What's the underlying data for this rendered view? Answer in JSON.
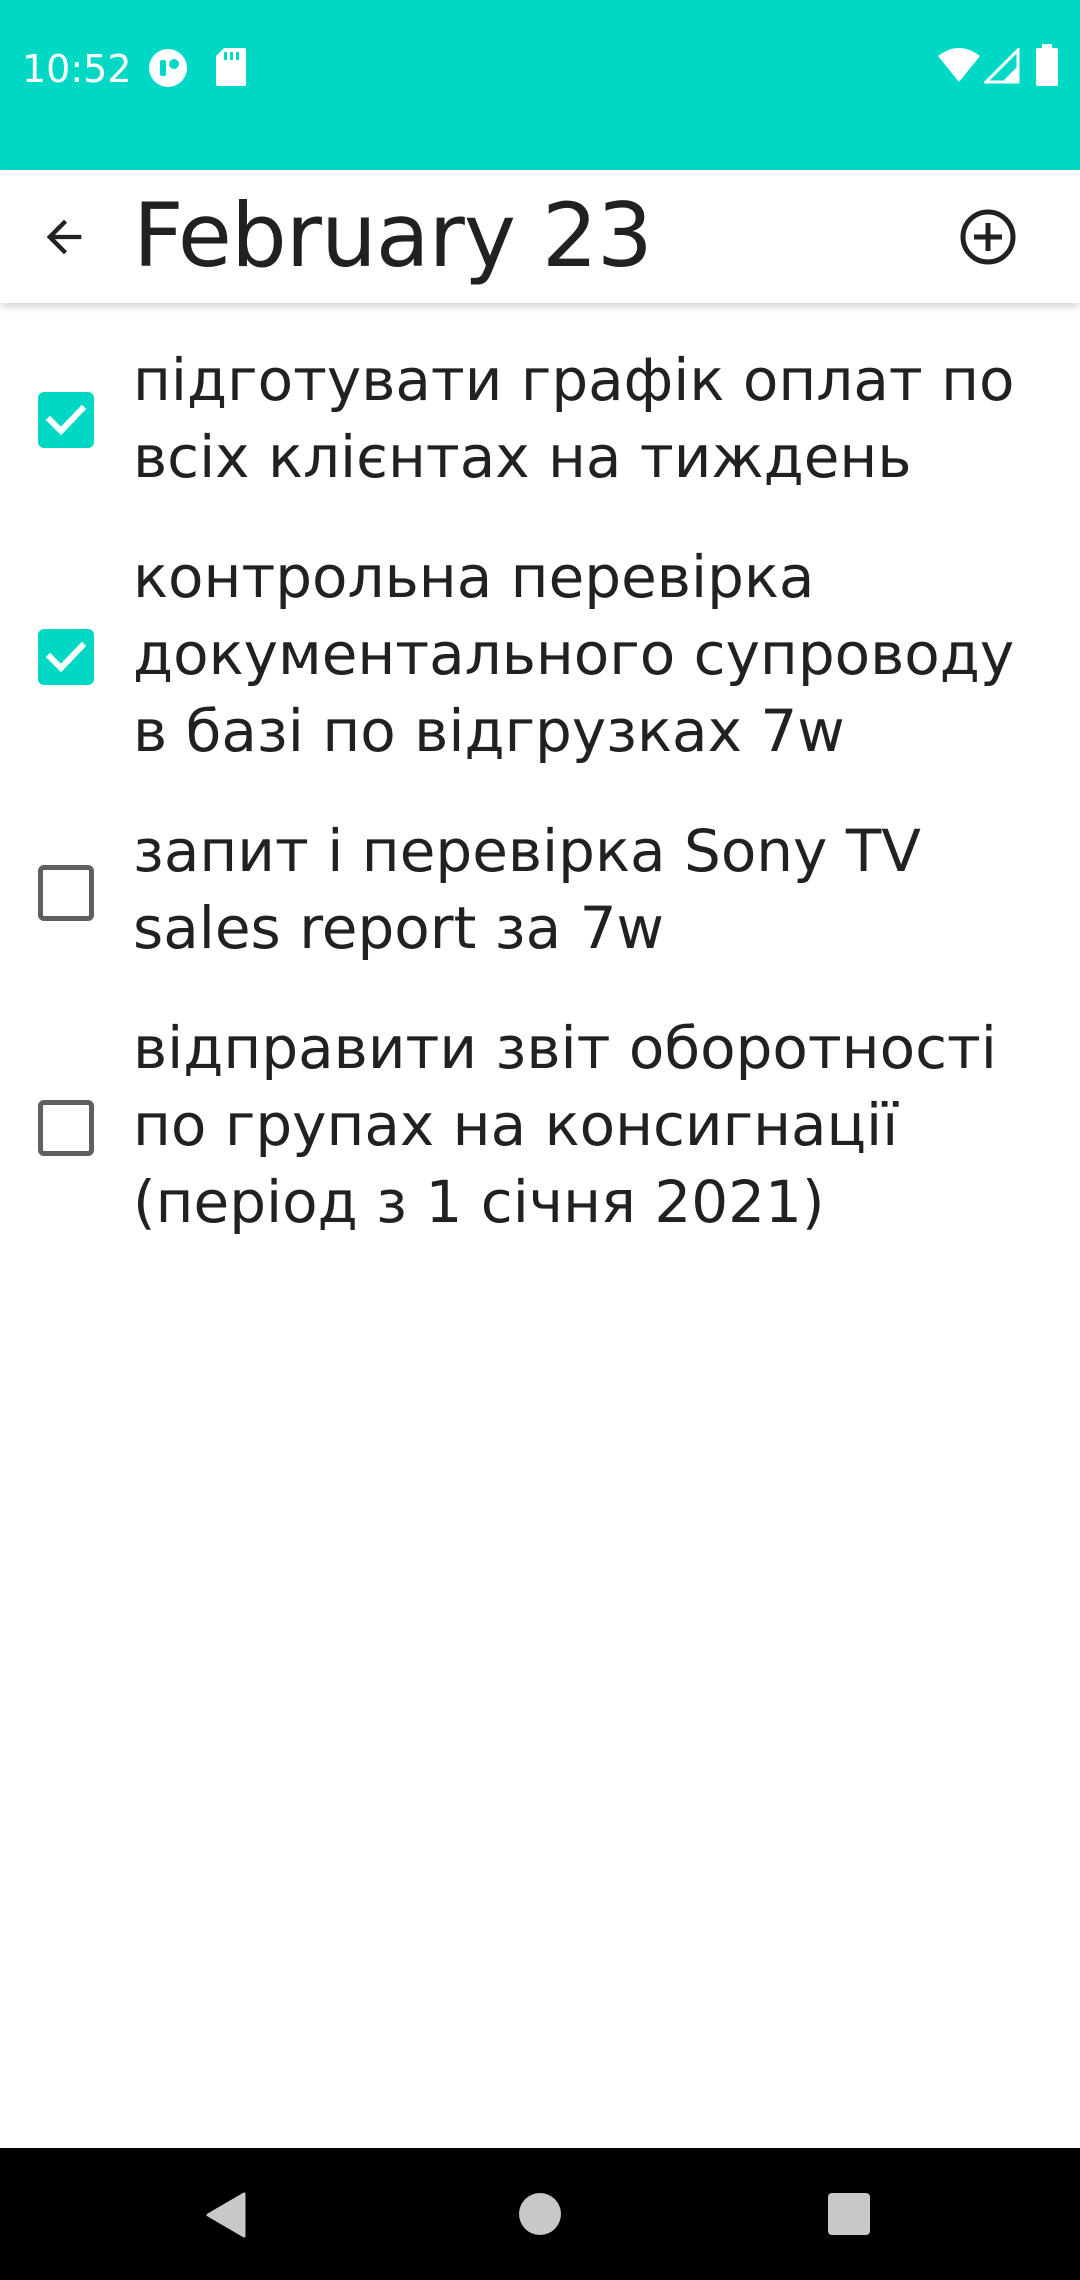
{
  "status_bar": {
    "time": "10:52",
    "background_color": "#00d8c6",
    "left_icons": [
      "app-notification-icon",
      "sd-card-icon"
    ],
    "right_icons": [
      "wifi-icon",
      "cellular-signal-icon",
      "battery-icon"
    ]
  },
  "app_bar": {
    "title": "February 23",
    "back_icon": "arrow-back-icon",
    "add_icon": "add-circle-icon"
  },
  "accent_color": "#00d8c6",
  "tasks": [
    {
      "checked": true,
      "lines": [
        "підготувати графік оплат по",
        "всіх клієнтах на тиждень"
      ]
    },
    {
      "checked": true,
      "lines": [
        "контрольна перевірка",
        "документального супроводу",
        "в базі по відгрузках 7w"
      ]
    },
    {
      "checked": false,
      "lines": [
        "запит і перевірка Sony TV",
        "sales report за 7w"
      ]
    },
    {
      "checked": false,
      "lines": [
        "відправити звіт оборотності",
        "по групах на консигнації",
        "(період з 1 січня 2021)"
      ]
    }
  ],
  "nav_bar": {
    "icons": [
      "nav-back-icon",
      "nav-home-icon",
      "nav-recents-icon"
    ]
  }
}
